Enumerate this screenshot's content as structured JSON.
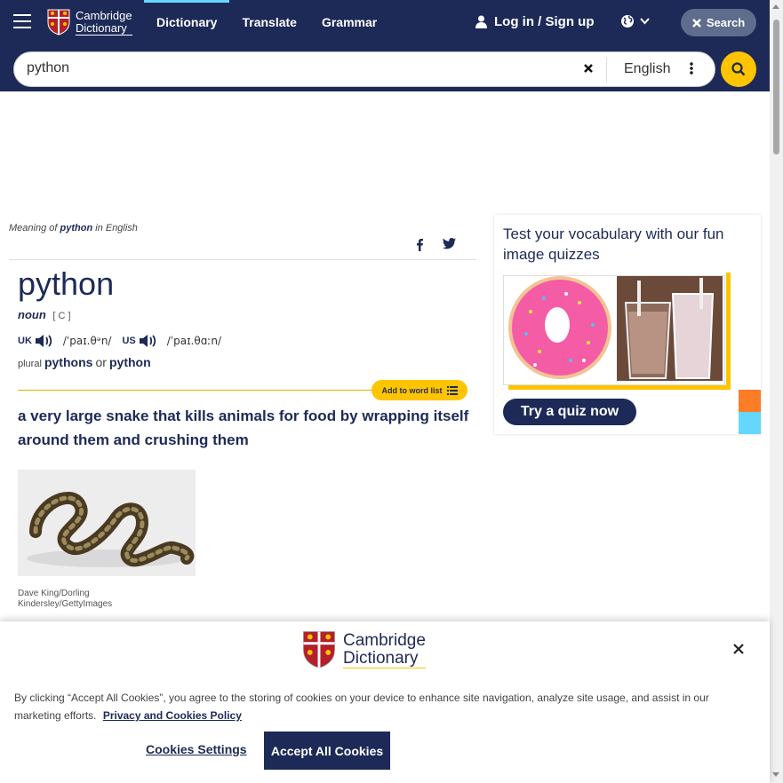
{
  "header": {
    "logo": {
      "line1": "Cambridge",
      "line2": "Dictionary"
    },
    "nav": [
      {
        "label": "Dictionary",
        "active": true
      },
      {
        "label": "Translate",
        "active": false
      },
      {
        "label": "Grammar",
        "active": false
      }
    ],
    "login_label": "Log in / Sign up",
    "search_button_label": "Search"
  },
  "search": {
    "value": "python",
    "language": "English"
  },
  "entry": {
    "meaning_prefix": "Meaning of",
    "meaning_word": "python",
    "meaning_suffix": "in English",
    "headword": "python",
    "pos": "noun",
    "grammar_code": "[ C ]",
    "uk_label": "UK",
    "uk_ipa": "/ˈpaɪ.θᵊn/",
    "us_label": "US",
    "us_ipa": "/ˈpaɪ.θɑːn/",
    "plural_label": "plural",
    "plural_1": "pythons",
    "plural_or": "or",
    "plural_2": "python",
    "wordlist_label": "Add to word list",
    "definition": "a very large snake that kills animals for food by wrapping itself around them and crushing them",
    "image_credit": "Dave King/Dorling Kindersley/GettyImages"
  },
  "quiz": {
    "title": "Test your vocabulary with our fun image quizzes",
    "button_label": "Try a quiz now"
  },
  "cookie": {
    "logo": {
      "line1": "Cambridge",
      "line2": "Dictionary"
    },
    "text": "By clicking “Accept All Cookies”, you agree to the storing of cookies on your device to enhance site navigation, analyze site usage, and assist in our marketing efforts.",
    "policy_link": "Privacy and Cookies Policy",
    "settings_label": "Cookies Settings",
    "accept_label": "Accept All Cookies"
  },
  "colors": {
    "brand_navy": "#1d2a57",
    "accent_yellow": "#fec400",
    "accent_cyan": "#65d7ff",
    "accent_orange": "#fd7d27"
  }
}
